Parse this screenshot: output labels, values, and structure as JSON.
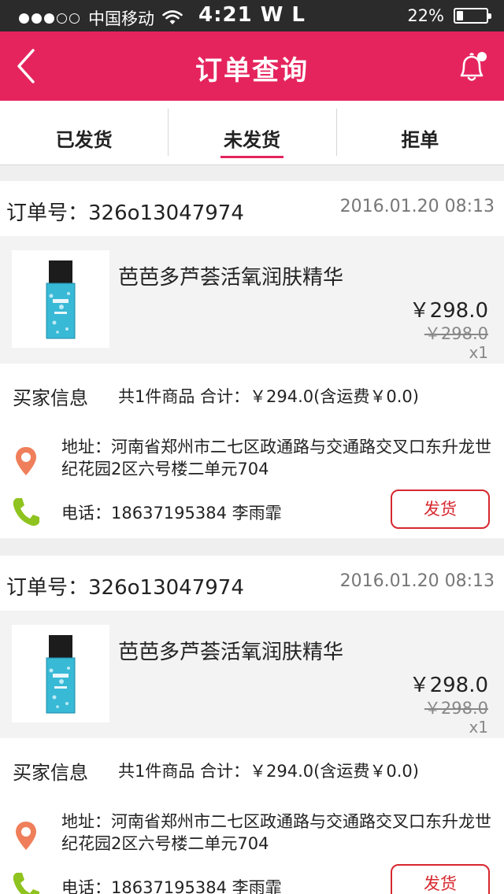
{
  "status_bar": {
    "carrier": "中国移动",
    "time": "4:21 W L",
    "battery": "22%",
    "battery_level": 0.22,
    "signal_bars_filled": 3,
    "signal_bars_total": 5
  },
  "nav": {
    "title": "订单查询",
    "back_icon": "chevron-left-icon",
    "bell_icon": "bell-icon",
    "accent": "#e5245d"
  },
  "tabs": [
    {
      "label": "已发货",
      "active": false
    },
    {
      "label": "未发货",
      "active": true
    },
    {
      "label": "拒单",
      "active": false
    }
  ],
  "orders": [
    {
      "order_no": "订单号：326o13047974",
      "time": "2016.01.20  08:13",
      "product_name": "芭芭多芦荟活氧润肤精华",
      "price": "￥298.0",
      "original_price": "￥298.0",
      "qty": "x1",
      "buyer_label": "买家信息",
      "summary": "共1件商品  合计：￥294.0(含运费￥0.0)",
      "address": "地址：河南省郑州市二七区政通路与交通路交叉口东升龙世纪花园2区六号楼二单元704",
      "phone": "电话：18637195384  李雨霏",
      "ship_label": "发货"
    },
    {
      "order_no": "订单号：326o13047974",
      "time": "2016.01.20  08:13",
      "product_name": "芭芭多芦荟活氧润肤精华",
      "price": "￥298.0",
      "original_price": "￥298.0",
      "qty": "x1",
      "buyer_label": "买家信息",
      "summary": "共1件商品  合计：￥294.0(含运费￥0.0)",
      "address": "地址：河南省郑州市二七区政通路与交通路交叉口东升龙世纪花园2区六号楼二单元704",
      "phone": "电话：18637195384  李雨霏",
      "ship_label": "发货"
    }
  ],
  "colors": {
    "ship_button": "#d7282f",
    "location_icon": "#ef7f5a",
    "phone_icon": "#8fc31f"
  }
}
